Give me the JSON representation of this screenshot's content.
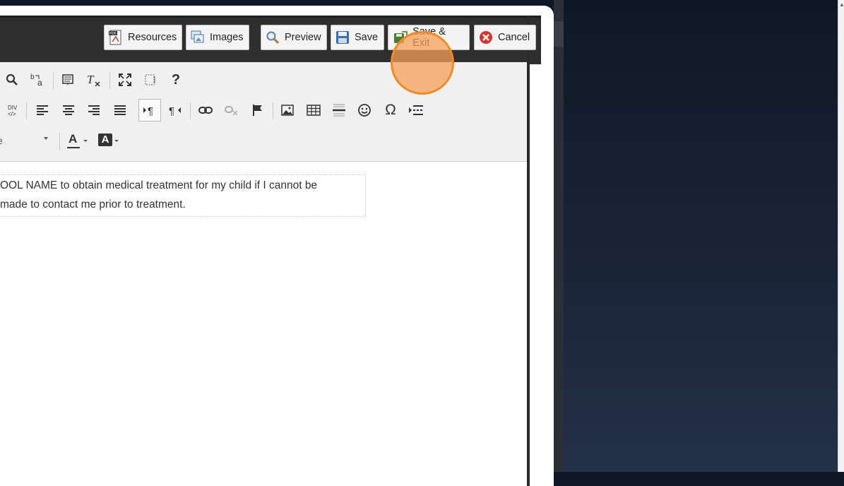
{
  "header": {
    "buttons": {
      "resources": "Resources",
      "images": "Images",
      "preview": "Preview",
      "save": "Save",
      "save_exit": "Save & Exit",
      "cancel": "Cancel"
    }
  },
  "toolbar": {
    "row1_icons": [
      "find-icon",
      "replace-icon",
      "templates-icon",
      "remove-format-icon",
      "maximize-icon",
      "show-blocks-icon",
      "help-icon"
    ],
    "row2_icons": [
      "div-container-icon",
      "align-left-icon",
      "align-center-icon",
      "align-right-icon",
      "justify-icon",
      "ltr-icon",
      "rtl-icon",
      "link-icon",
      "unlink-icon",
      "anchor-icon",
      "image-icon",
      "table-icon",
      "horizontal-line-icon",
      "smiley-icon",
      "special-char-icon",
      "page-break-icon"
    ],
    "font_size_partial": "e",
    "text_color_glyph": "A",
    "bg_color_glyph": "A",
    "help_glyph": "?",
    "omega_glyph": "Ω"
  },
  "content": {
    "line1": "OOL NAME to obtain medical treatment for my child if I cannot be",
    "line2": "made to contact me prior to treatment."
  },
  "colors": {
    "header_bg": "#2f2f2f",
    "toolbar_bg": "#f0f0f0",
    "click_marker": "#f08a24",
    "cancel_red": "#d9342b"
  }
}
